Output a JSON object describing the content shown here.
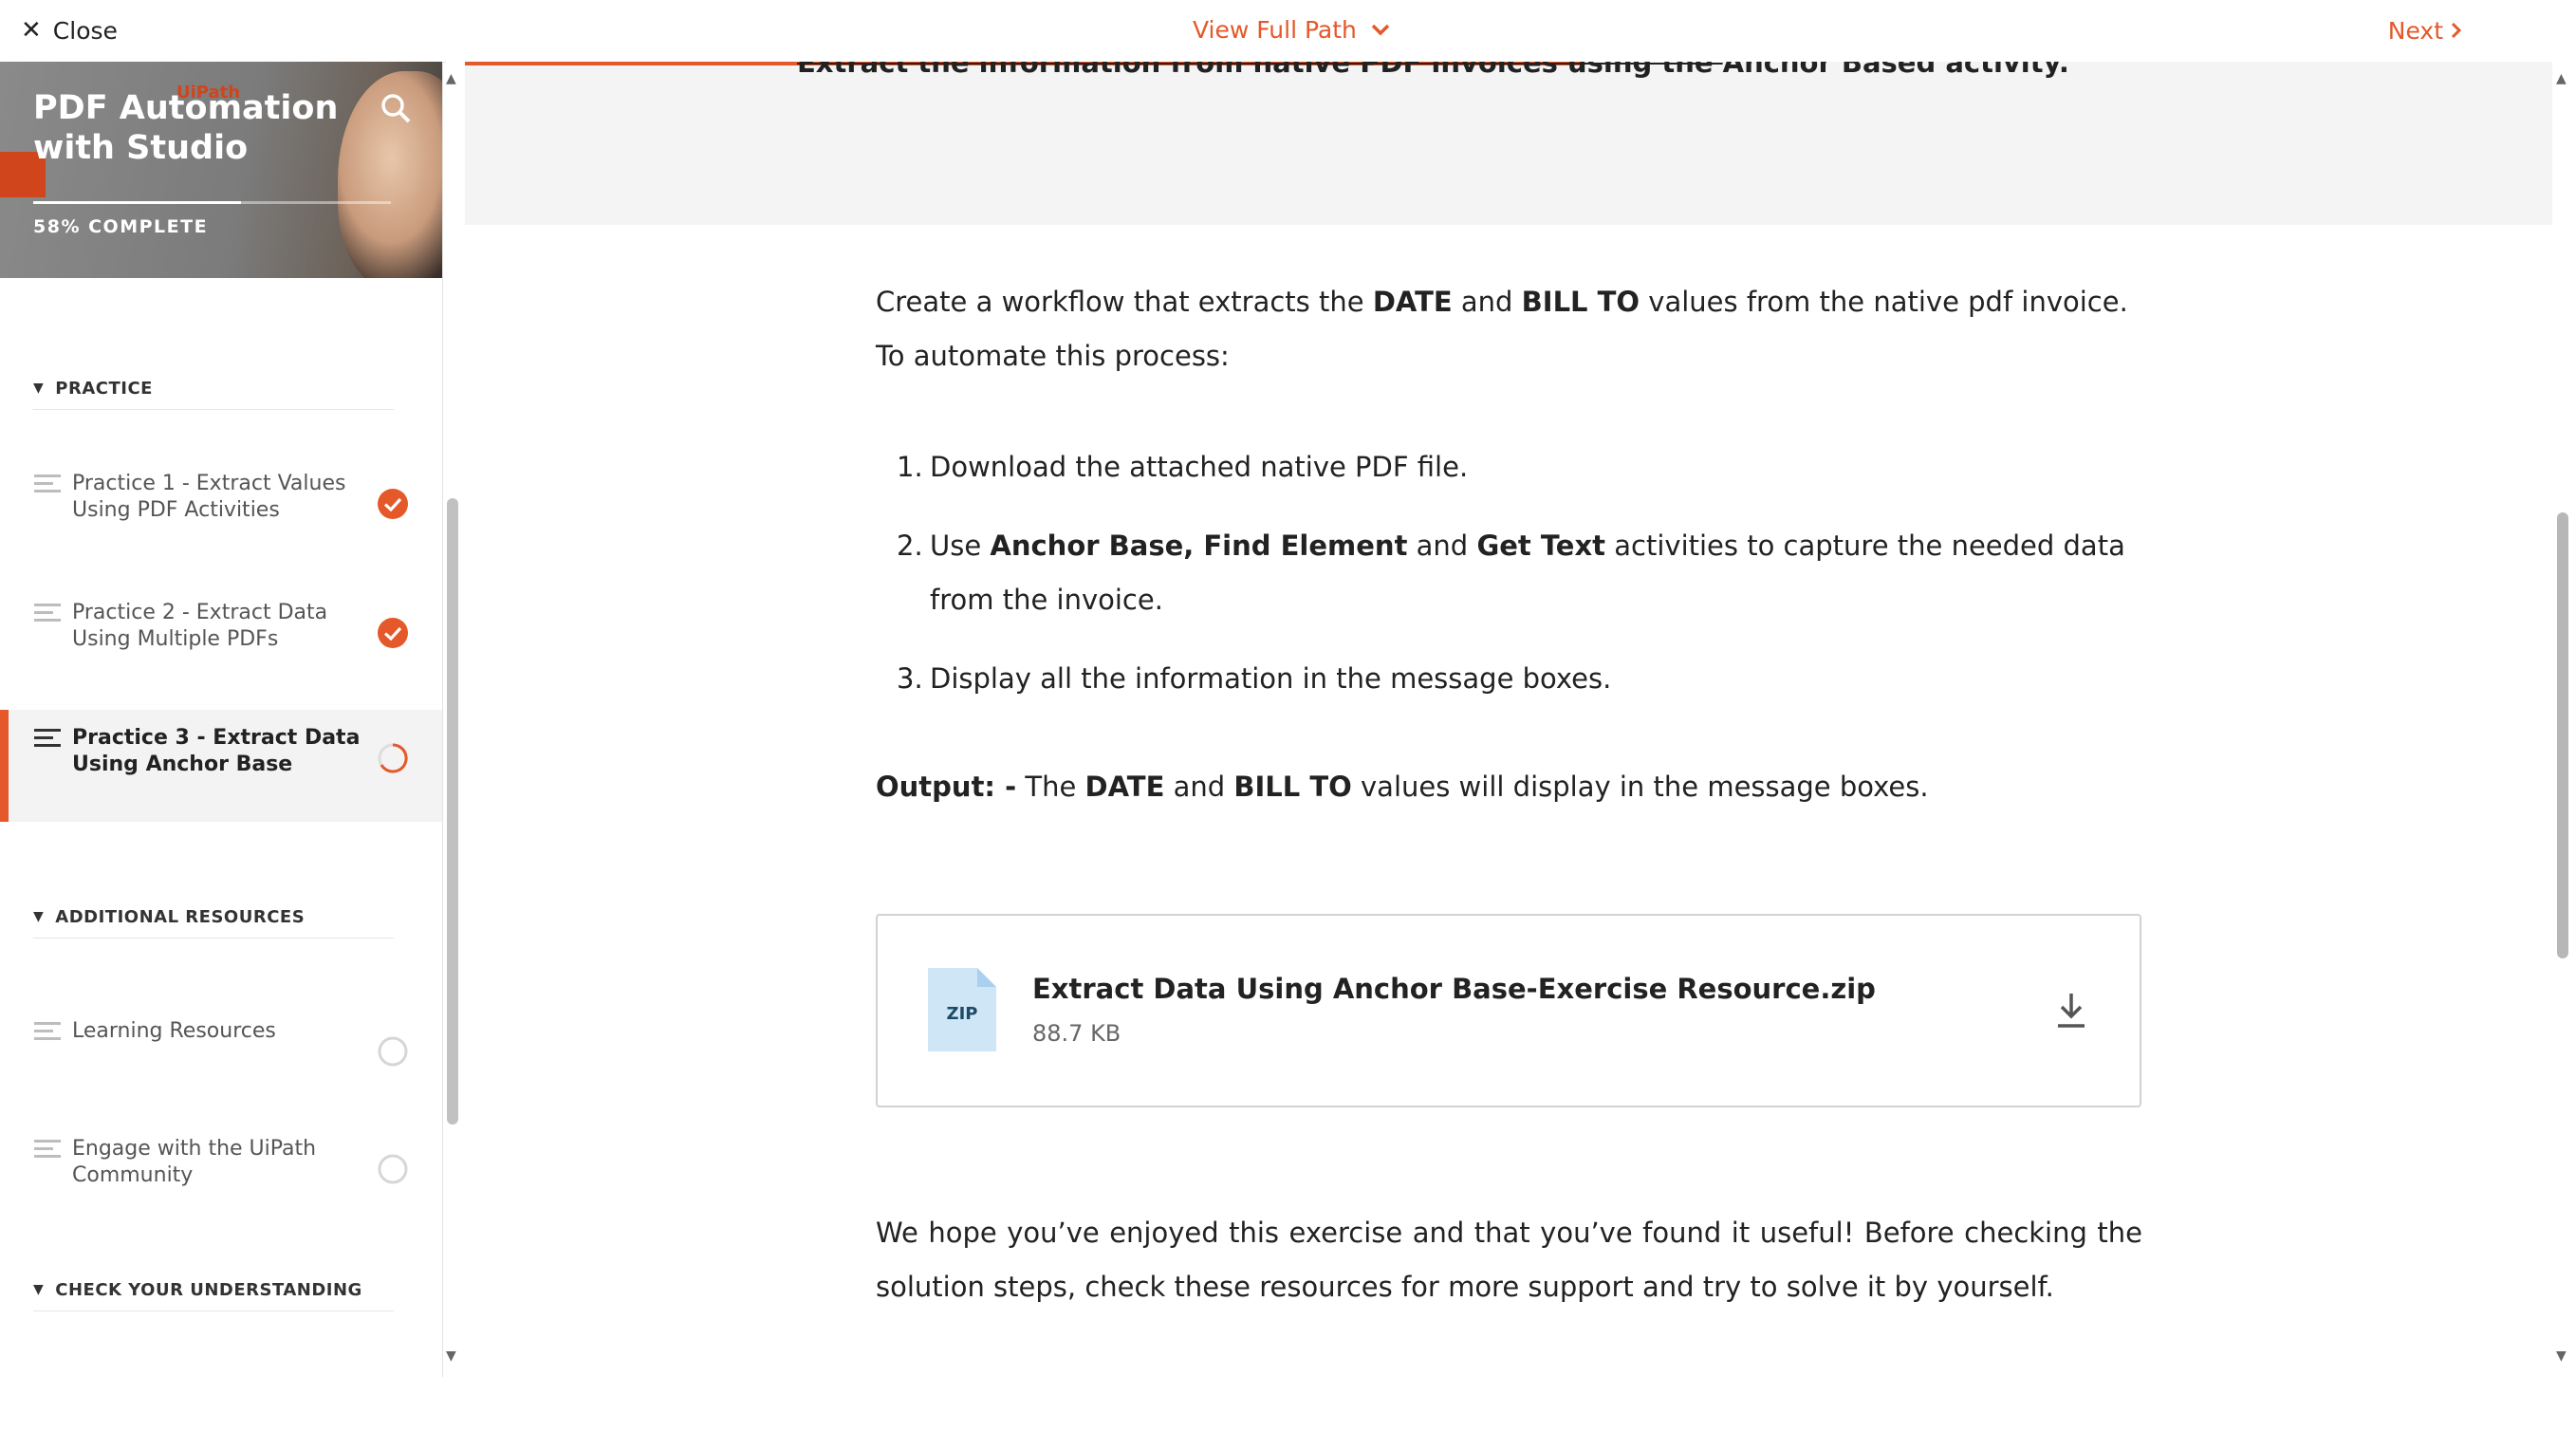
{
  "topbar": {
    "close_label": "Close",
    "view_path_label": "View Full Path",
    "next_label": "Next"
  },
  "sidebar": {
    "course_title": "PDF Automation with Studio",
    "logo_text": "UiPath",
    "progress_percent": 58,
    "progress_label": "58% COMPLETE",
    "sections": [
      {
        "label": "PRACTICE",
        "lessons": [
          {
            "title": "Practice 1 - Extract Values Using PDF Activities",
            "status": "complete"
          },
          {
            "title": "Practice 2 - Extract Data Using Multiple PDFs",
            "status": "complete"
          },
          {
            "title": "Practice 3 - Extract Data Using Anchor Base",
            "status": "in-progress"
          }
        ]
      },
      {
        "label": "ADDITIONAL RESOURCES",
        "lessons": [
          {
            "title": "Learning Resources",
            "status": "not-started"
          },
          {
            "title": "Engage with the UiPath Community",
            "status": "not-started"
          }
        ]
      },
      {
        "label": "CHECK YOUR UNDERSTANDING",
        "lessons": []
      }
    ]
  },
  "main": {
    "cut_heading": {
      "pre": "Extract the information from native PDF invoices using the ",
      "post": "Anchor Based activity."
    },
    "intro": {
      "t1": "Create a workflow that extracts the ",
      "b1": "DATE",
      "t2": " and ",
      "b2": "BILL TO",
      "t3": " values from the native pdf invoice. To automate this process:"
    },
    "steps": [
      {
        "num": "1.",
        "text": "Download the attached native PDF file."
      },
      {
        "num": "2.",
        "t1": "Use ",
        "b1": "Anchor Base, Find Element",
        "t2": " and ",
        "b2": "Get Text",
        "t3": " activities to capture the needed data from the invoice."
      },
      {
        "num": "3.",
        "text": "Display all the information in the message boxes."
      }
    ],
    "output": {
      "b0": "Output: -",
      "t1": " The ",
      "b1": "DATE",
      "t2": " and ",
      "b2": "BILL TO",
      "t3": " values will display in the message boxes."
    },
    "file": {
      "icon_label": "ZIP",
      "name": "Extract Data Using Anchor Base-Exercise Resource.zip",
      "size": "88.7 KB"
    },
    "closing": "We hope you’ve enjoyed this exercise and that you’ve found it useful! Before checking the solution steps, check these resources for more support and try to solve it by yourself."
  },
  "colors": {
    "accent": "#e4582a",
    "complete_badge": "#e4582a"
  },
  "icons": [
    "close-icon",
    "chevron-down-icon",
    "chevron-right-icon",
    "search-icon",
    "lesson-lines-icon",
    "check-circle-icon",
    "progress-ring-icon",
    "empty-circle-icon",
    "zip-file-icon",
    "download-icon"
  ]
}
